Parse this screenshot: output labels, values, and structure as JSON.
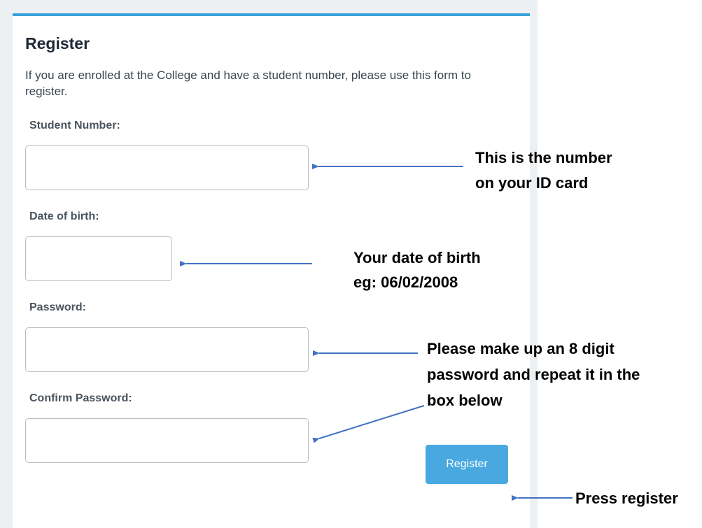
{
  "form": {
    "title": "Register",
    "intro": "If you are enrolled at the College and have a student number, please use this form to register.",
    "student_number_label": "Student Number:",
    "student_number_value": "",
    "dob_label": "Date of birth:",
    "dob_value": "",
    "password_label": "Password:",
    "password_value": "",
    "confirm_password_label": "Confirm Password:",
    "confirm_password_value": "",
    "register_button_label": "Register"
  },
  "annotations": {
    "student_number_line1": "This is the number",
    "student_number_line2": "on your ID card",
    "dob_line1": "Your date of birth",
    "dob_line2": "eg: 06/02/2008",
    "password_line1": "Please make up an 8 digit",
    "password_line2": "password and repeat it in the",
    "password_line3": "box below",
    "register_line": "Press register"
  },
  "colors": {
    "accent": "#3aa2dc",
    "button": "#4aa8e0",
    "arrow": "#4472c4",
    "page_background": "#edf0f3"
  }
}
